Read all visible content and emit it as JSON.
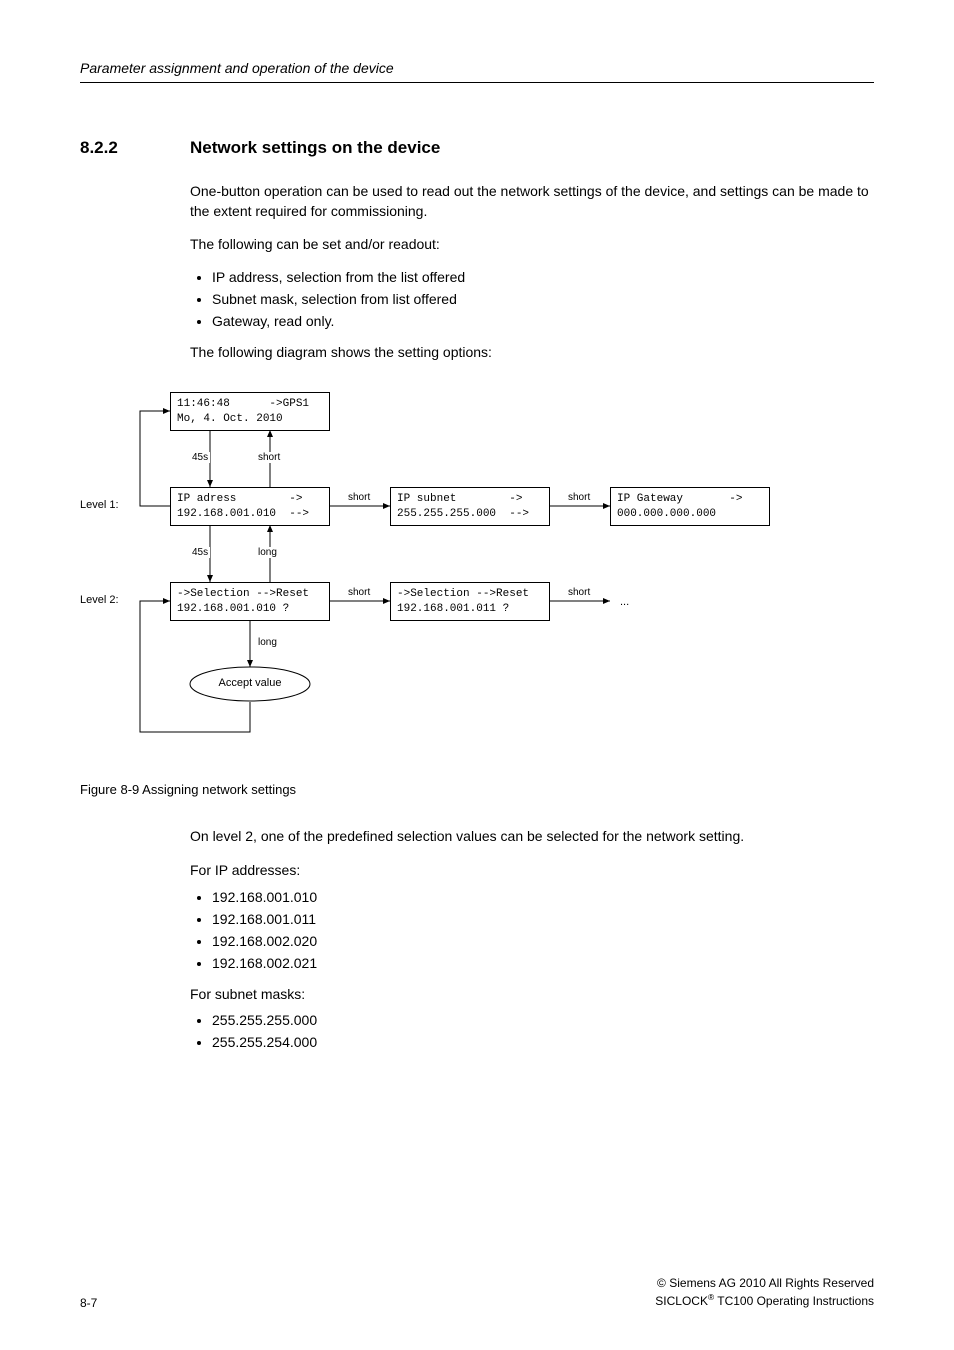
{
  "header": {
    "running": "Parameter assignment and operation of the device"
  },
  "section": {
    "number": "8.2.2",
    "title": "Network settings on the device"
  },
  "body": {
    "p1": "One-button operation can be used to read out the network settings of the device, and settings can be made to the extent required for commissioning.",
    "p2": "The following can be set and/or readout:",
    "bul1": [
      "IP address, selection from the list offered",
      "Subnet mask, selection from list offered",
      "Gateway, read only."
    ],
    "p3": "The following diagram shows the setting options:"
  },
  "diagram": {
    "level1Label": "Level 1:",
    "level2Label": "Level 2:",
    "startNode": "11:46:48      ->GPS1\nMo, 4. Oct. 2010",
    "l1n1": "IP adress        ->\n192.168.001.010  -->",
    "l1n2": "IP subnet        ->\n255.255.255.000  -->",
    "l1n3": "IP Gateway       ->\n000.000.000.000",
    "l2n1": "->Selection -->Reset\n192.168.001.010 ?",
    "l2n2": "->Selection -->Reset\n192.168.001.011 ?",
    "ell": "...",
    "accept": "Accept value",
    "edge45s_a": "45s",
    "edgeShort_a": "short",
    "edgeShort_b": "short",
    "edgeShort_c": "short",
    "edge45s_b": "45s",
    "edgeLong_a": "long",
    "edgeShort_d": "short",
    "edgeShort_e": "short",
    "edgeLong_b": "long"
  },
  "figure": {
    "caption": "Figure 8-9 Assigning network settings"
  },
  "after": {
    "p1": "On level 2, one of the predefined selection values can be selected for the network setting.",
    "p2": "For IP addresses:",
    "bul_ip": [
      "192.168.001.010",
      "192.168.001.011",
      "192.168.002.020",
      "192.168.002.021"
    ],
    "p3": "For subnet masks:",
    "bul_sn": [
      "255.255.255.000",
      "255.255.254.000"
    ]
  },
  "footer": {
    "pageno": "8-7",
    "copyright": "© Siemens AG 2010 All Rights Reserved",
    "docline": "SICLOCK® TC100 Operating Instructions"
  }
}
